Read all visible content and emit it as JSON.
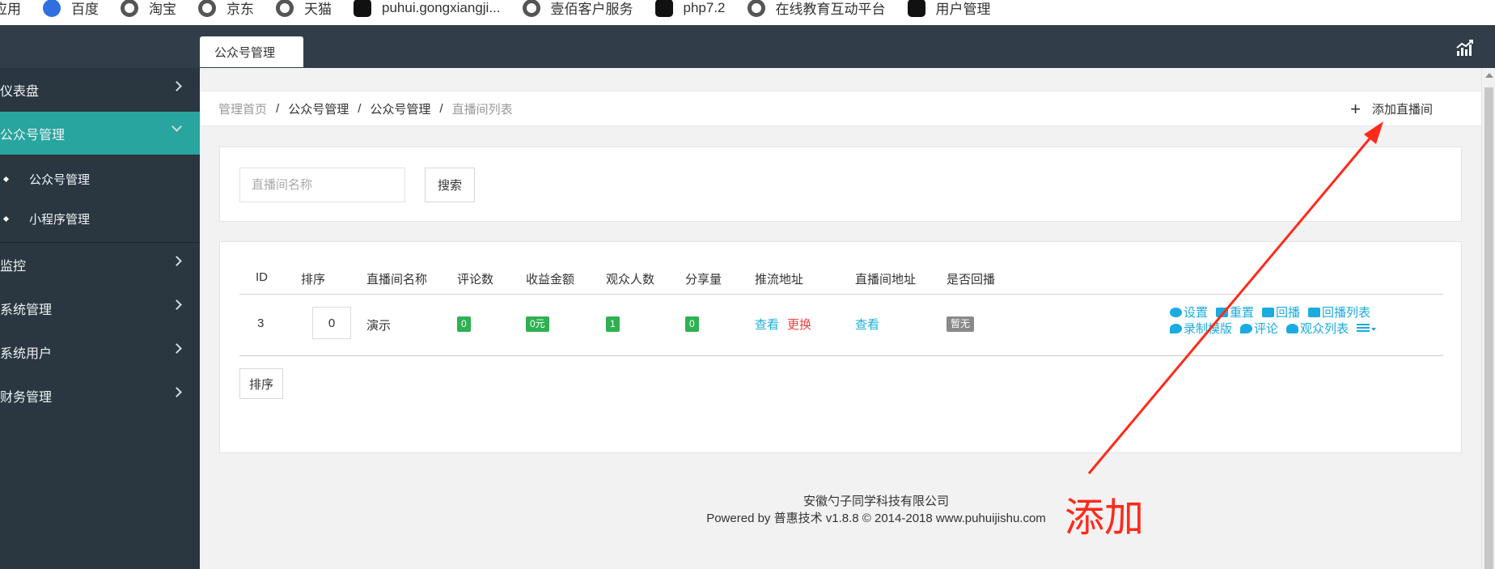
{
  "bookmarks": [
    {
      "label": "应用",
      "icon": "none"
    },
    {
      "label": "百度",
      "icon": "baidu-icon"
    },
    {
      "label": "淘宝",
      "icon": "globe-icon"
    },
    {
      "label": "京东",
      "icon": "globe-icon"
    },
    {
      "label": "天猫",
      "icon": "globe-icon"
    },
    {
      "label": "puhui.gongxiangji...",
      "icon": "box-icon"
    },
    {
      "label": "壹佰客户服务",
      "icon": "globe-icon"
    },
    {
      "label": "php7.2",
      "icon": "box-icon"
    },
    {
      "label": "在线教育互动平台",
      "icon": "globe-icon"
    },
    {
      "label": "用户管理",
      "icon": "box-icon"
    }
  ],
  "topbar": {
    "active_tab": "公众号管理",
    "right_icon": "bar-chart-icon"
  },
  "sidebar": {
    "items": [
      {
        "label": "仪表盘"
      },
      {
        "label": "公众号管理",
        "active": true
      },
      {
        "label": "监控"
      },
      {
        "label": "系统管理"
      },
      {
        "label": "系统用户"
      },
      {
        "label": "财务管理"
      }
    ],
    "submenu": [
      {
        "label": "公众号管理"
      },
      {
        "label": "小程序管理"
      }
    ]
  },
  "breadcrumb": {
    "items": [
      "管理首页",
      "公众号管理",
      "公众号管理",
      "直播间列表"
    ],
    "separator": "/"
  },
  "add_button": {
    "label": "添加直播间",
    "icon": "plus-icon"
  },
  "search": {
    "placeholder": "直播间名称",
    "button": "搜索"
  },
  "table": {
    "headers": [
      "ID",
      "排序",
      "直播间名称",
      "评论数",
      "收益金额",
      "观众人数",
      "分享量",
      "推流地址",
      "直播间地址",
      "是否回播"
    ],
    "rows": [
      {
        "id": "3",
        "sort": "0",
        "name": "演示",
        "comments": "0",
        "income": "0元",
        "viewers": "1",
        "shares": "0",
        "push_view": "查看",
        "push_change": "更换",
        "room_view": "查看",
        "replay": "暂无",
        "actions": [
          "设置",
          "重置",
          "回播",
          "回播列表",
          "录制模版",
          "评论",
          "观众列表"
        ]
      }
    ],
    "sort_button": "排序"
  },
  "footer": {
    "company": "安徽勺子同学科技有限公司",
    "powered": "Powered by 普惠技术 v1.8.8 © 2014-2018 www.puhuijishu.com"
  },
  "annotation": {
    "text": "添加",
    "color": "#ff2a1b"
  },
  "colors": {
    "sidebar": "#2a3740",
    "topbar": "#313e49",
    "active": "#27a59e",
    "link": "#1ab0d9",
    "badge": "#2fb152"
  }
}
